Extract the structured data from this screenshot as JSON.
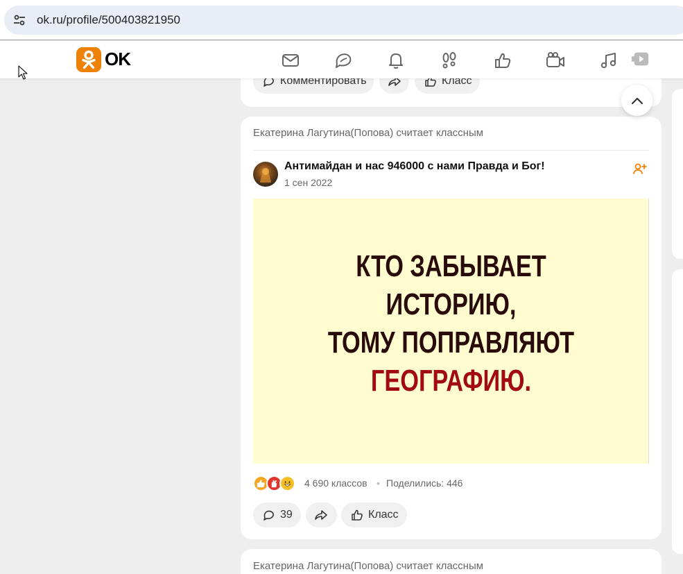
{
  "browser": {
    "url": "ok.ru/profile/500403821950"
  },
  "nav": {
    "logo_text": "OK",
    "icons": [
      "messages-icon",
      "discussions-icon",
      "notifications-icon",
      "guests-icon",
      "reactions-icon",
      "video-call-icon",
      "music-icon",
      "video-icon"
    ]
  },
  "prev_post": {
    "comment_label": "Комментировать",
    "like_label": "Класс"
  },
  "post": {
    "liked_by": "Екатерина Лагутина(Попова) считает классным",
    "group_name": "Антимайдан и нас 946000 с нами Правда и Бог!",
    "date": "1 сен 2022",
    "image_lines": [
      "КТО ЗАБЫВАЕТ",
      "ИСТОРИЮ,",
      "ТОМУ ПОПРАВЛЯЮТ",
      "ГЕОГРАФИЮ."
    ],
    "likes_count": "4 690 классов",
    "separator": "•",
    "shares": "Поделились: 446",
    "comments_count": "39",
    "like_label": "Класс"
  },
  "next_post": {
    "liked_by": "Екатерина Лагутина(Попова) считает классным"
  },
  "colors": {
    "ok_orange": "#ee8208",
    "image_bg": "#fffdd0",
    "headline_dark": "#2a0b0b",
    "headline_red": "#a10b10"
  }
}
